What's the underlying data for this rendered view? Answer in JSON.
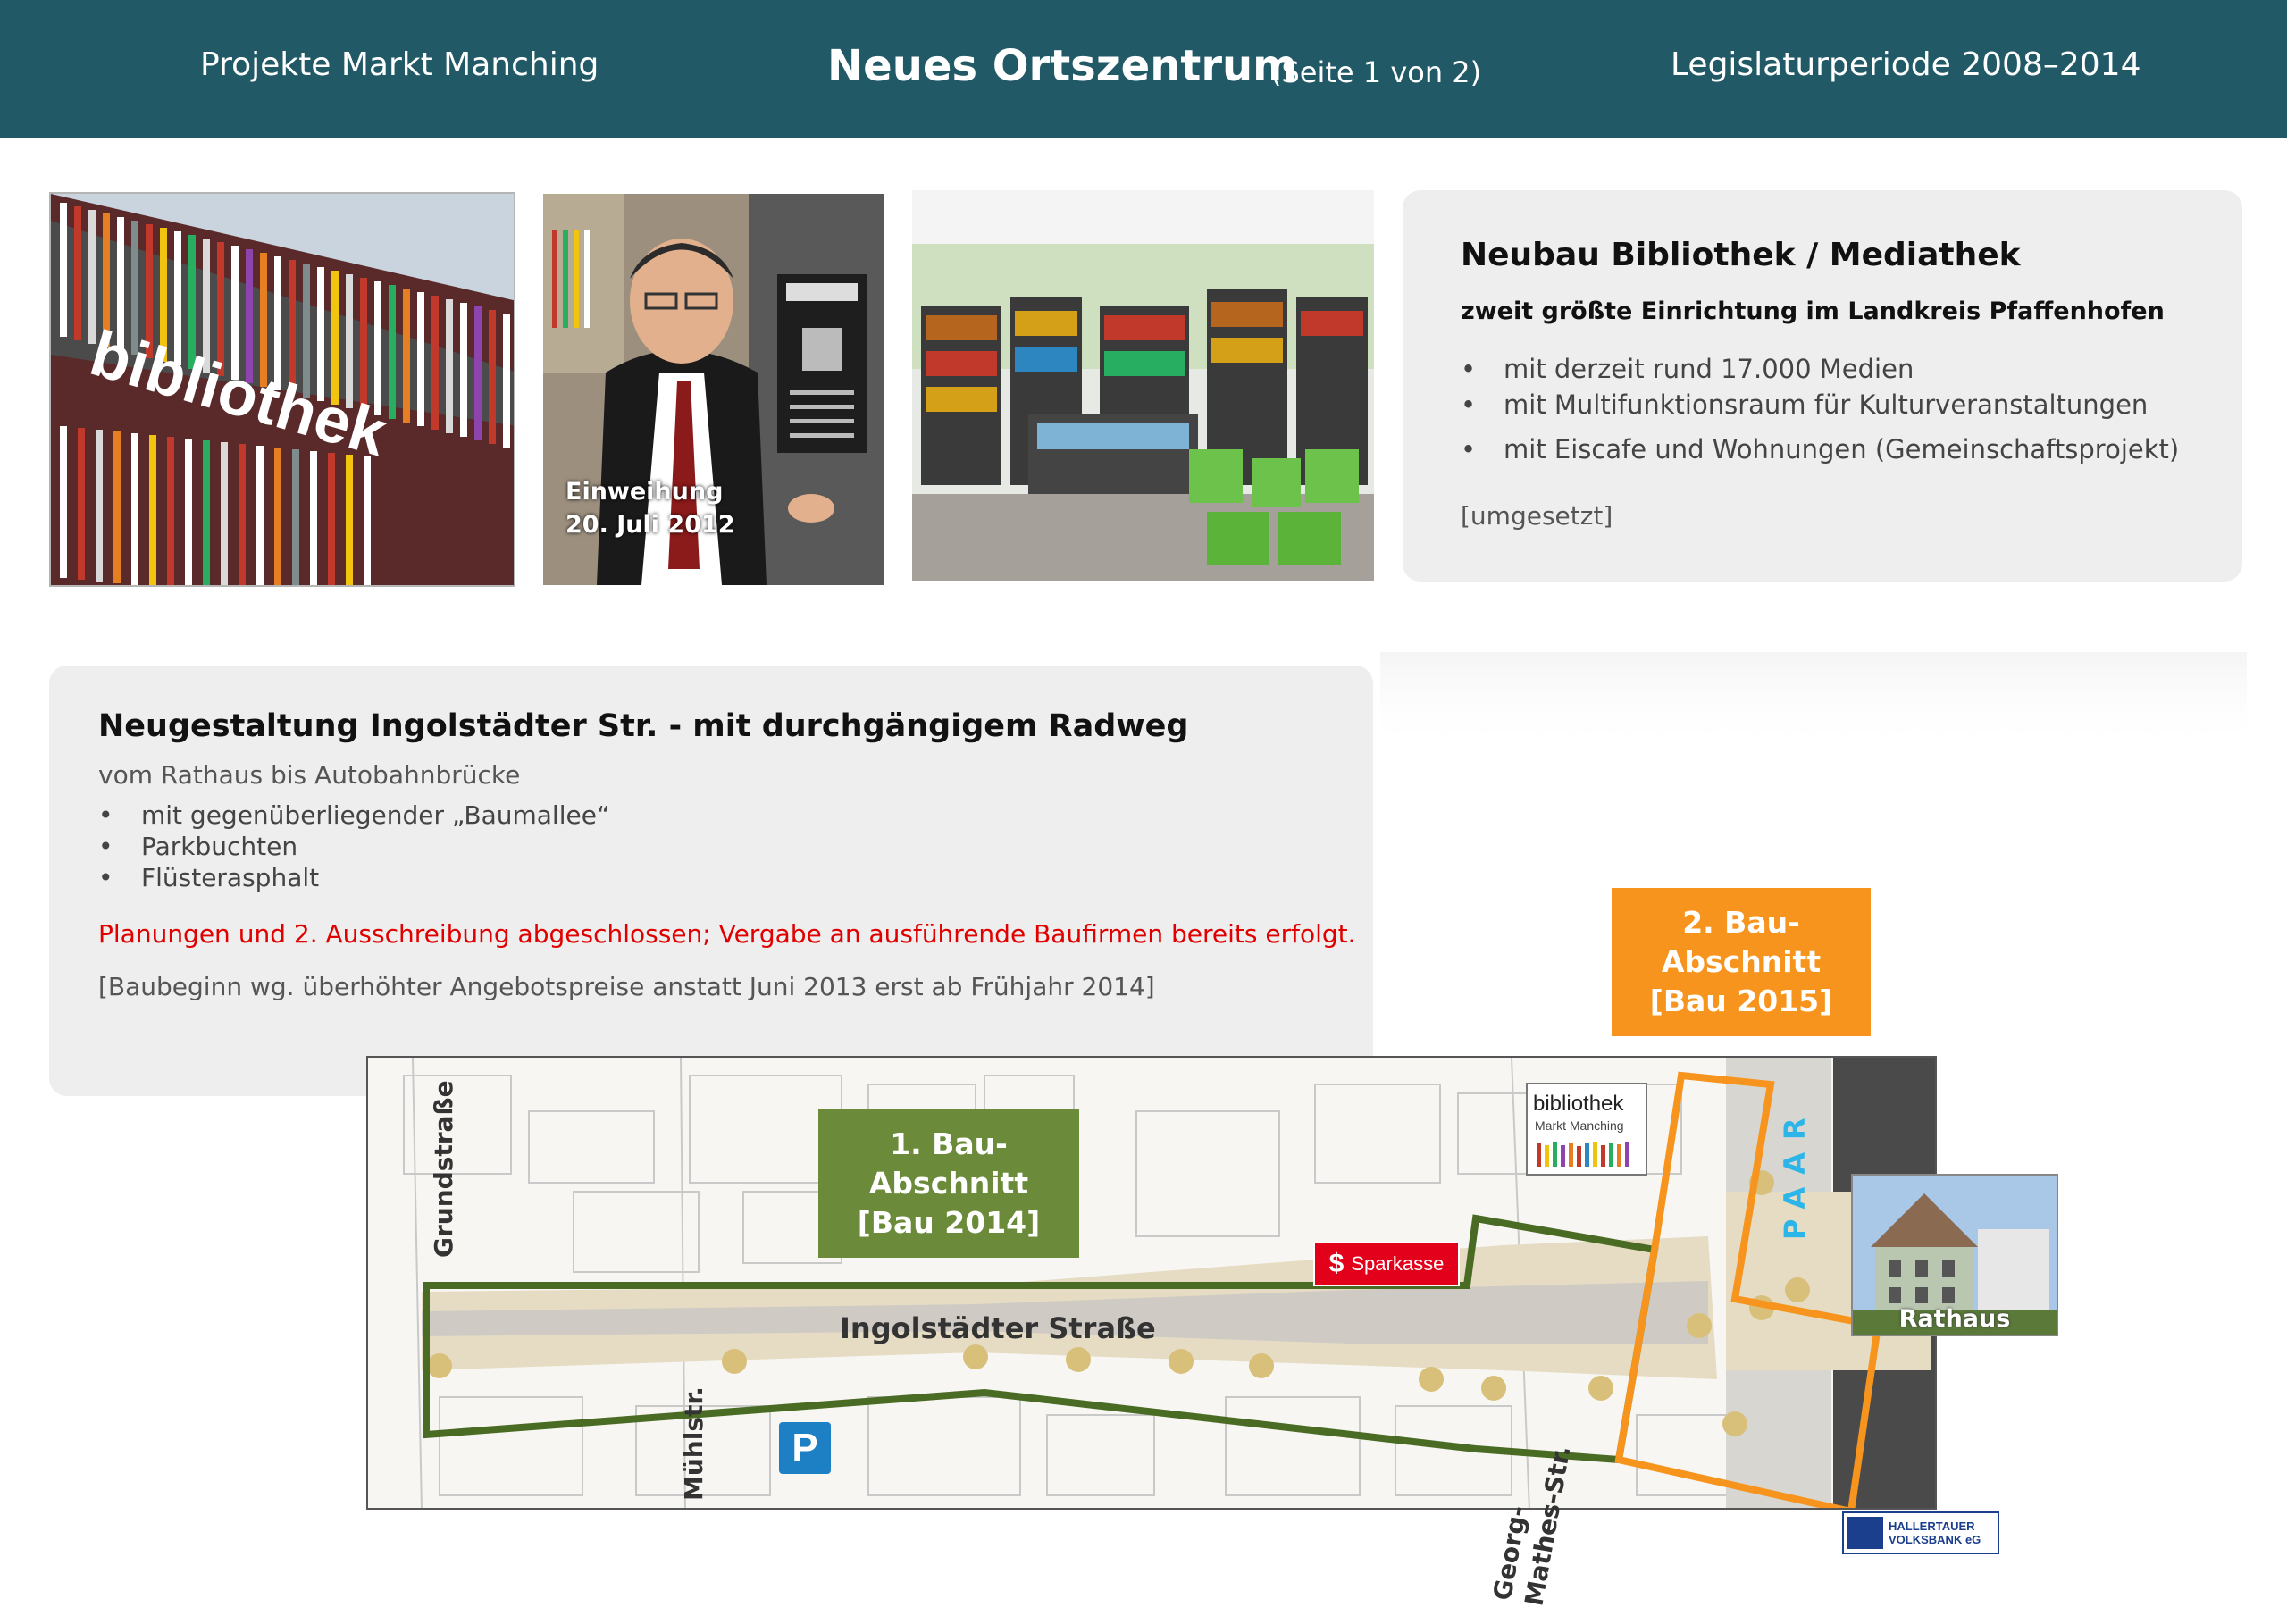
{
  "header": {
    "left": "Projekte Markt Manching",
    "title": "Neues Ortszentrum",
    "subtitle": "(Seite 1 von 2)",
    "right": "Legislaturperiode 2008–2014"
  },
  "photos": {
    "building_sign": "bibliothek",
    "inauguration_line1": "Einweihung",
    "inauguration_line2": "20. Juli 2012"
  },
  "library": {
    "title": "Neubau Bibliothek / Mediathek",
    "subtitle": "zweit größte Einrichtung im Landkreis Pfaffenhofen",
    "items": [
      "mit derzeit rund 17.000 Medien",
      "mit Multifunktionsraum für Kulturveranstaltungen",
      "mit Eiscafe und Wohnungen (Gemeinschaftsprojekt)"
    ],
    "status": "[umgesetzt]"
  },
  "street": {
    "title": "Neugestaltung Ingolstädter Str.  -  mit durchgängigem Radweg",
    "subtitle": "vom Rathaus bis Autobahnbrücke",
    "items": [
      "mit gegenüberliegender „Baumallee“",
      "Parkbuchten",
      "Flüsterasphalt"
    ],
    "status_red": "Planungen und 2. Ausschreibung abgeschlossen;  Vergabe an ausführende Baufirmen bereits erfolgt.",
    "note": "[Baubeginn wg. überhöhter Angebotspreise anstatt  Juni 2013 erst ab Frühjahr 2014]"
  },
  "map": {
    "section1_line1": "1. Bau-Abschnitt",
    "section1_line2": "[Bau 2014]",
    "section2_line1": "2. Bau-Abschnitt",
    "section2_line2": "[Bau 2015]",
    "section1_color": "#6b8b3a",
    "section2_color": "#f7941d",
    "street_main": "Ingolstädter Straße",
    "street_grund": "Grundstraße",
    "street_muehl": "Mühlstr.",
    "street_georg_line1": "Georg-",
    "street_georg_line2": "Mathes-Str.",
    "river": "PAAR",
    "bank": "Sparkasse",
    "bank_icon": "sparkasse-s-icon",
    "parking": "P",
    "library_logo_word": "bibliothek",
    "library_logo_sub": "Markt Manching",
    "townhall": "Rathaus",
    "volksbank_line1": "HALLERTAUER",
    "volksbank_line2": "VOLKSBANK eG"
  },
  "colors": {
    "header_bg": "#215966",
    "card_bg": "#eeeeee",
    "alert_red": "#e00000"
  }
}
